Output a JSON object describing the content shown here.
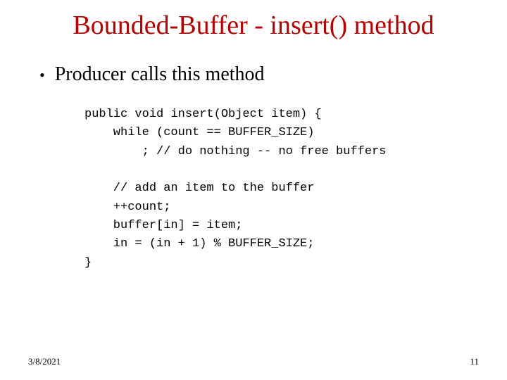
{
  "title": "Bounded-Buffer - insert() method",
  "bullet": {
    "marker": "•",
    "text": "Producer calls this method"
  },
  "code": {
    "l1": "public void insert(Object item) {",
    "l2": "    while (count == BUFFER_SIZE)",
    "l3": "        ; // do nothing -- no free buffers",
    "l4": "",
    "l5": "    // add an item to the buffer",
    "l6": "    ++count;",
    "l7": "    buffer[in] = item;",
    "l8": "    in = (in + 1) % BUFFER_SIZE;",
    "l9": "}"
  },
  "footer": {
    "date": "3/8/2021",
    "page": "11"
  }
}
